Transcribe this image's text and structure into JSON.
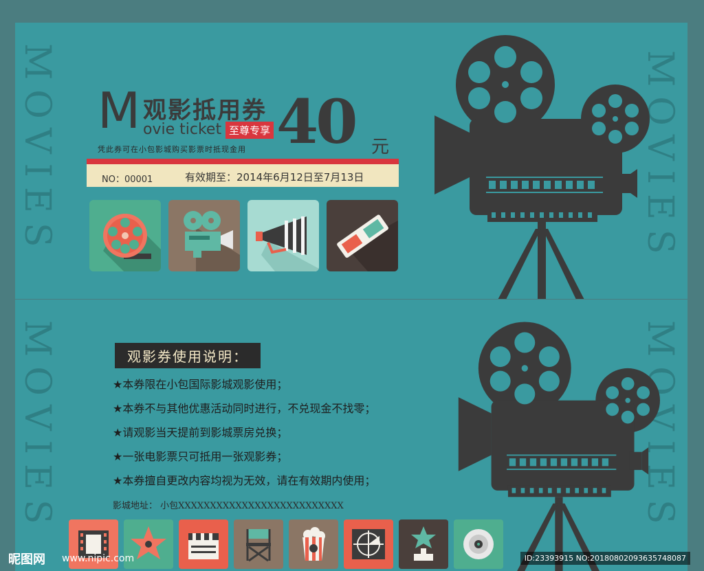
{
  "ticket": {
    "vertical_text": "MOVIES",
    "title_letter": "M",
    "title_cn": "观影抵用券",
    "title_en": "ovie ticket",
    "badge": "至尊专享",
    "price": "40",
    "currency": "元",
    "description": "凭此券可在小包影城购买影票时抵现金用",
    "number": "NO：00001",
    "validity": "有效期至：2014年6月12日至7月13日",
    "icons": [
      "film-reel-icon",
      "movie-projector-icon",
      "megaphone-icon",
      "3d-glasses-icon"
    ]
  },
  "notice": {
    "title": "观影券使用说明：",
    "rules": [
      "★本券限在小包国际影城观影使用；",
      "★本券不与其他优惠活动同时进行，不兑现金不找零；",
      "★请观影当天提前到影城票房兑换；",
      "★一张电影票只可抵用一张观影券；",
      "★本券擅自更改内容均视为无效，请在有效期内使用；"
    ],
    "address": "影城地址：   小包XXXXXXXXXXXXXXXXXXXXXXXXXX",
    "icons": [
      "film-strip-icon",
      "star-icon",
      "clapperboard-icon",
      "directors-chair-icon",
      "popcorn-icon",
      "film-leader-icon",
      "trophy-icon",
      "disc-icon"
    ]
  },
  "watermark": {
    "logo": "昵图网",
    "url": "www.nipic.com",
    "id": "ID:23393915 NO:20180802093635748087"
  },
  "colors": {
    "background": "#3a9aa0",
    "dark": "#3b3b3b",
    "accent": "#d9363e",
    "cream": "#f1e6bf"
  }
}
